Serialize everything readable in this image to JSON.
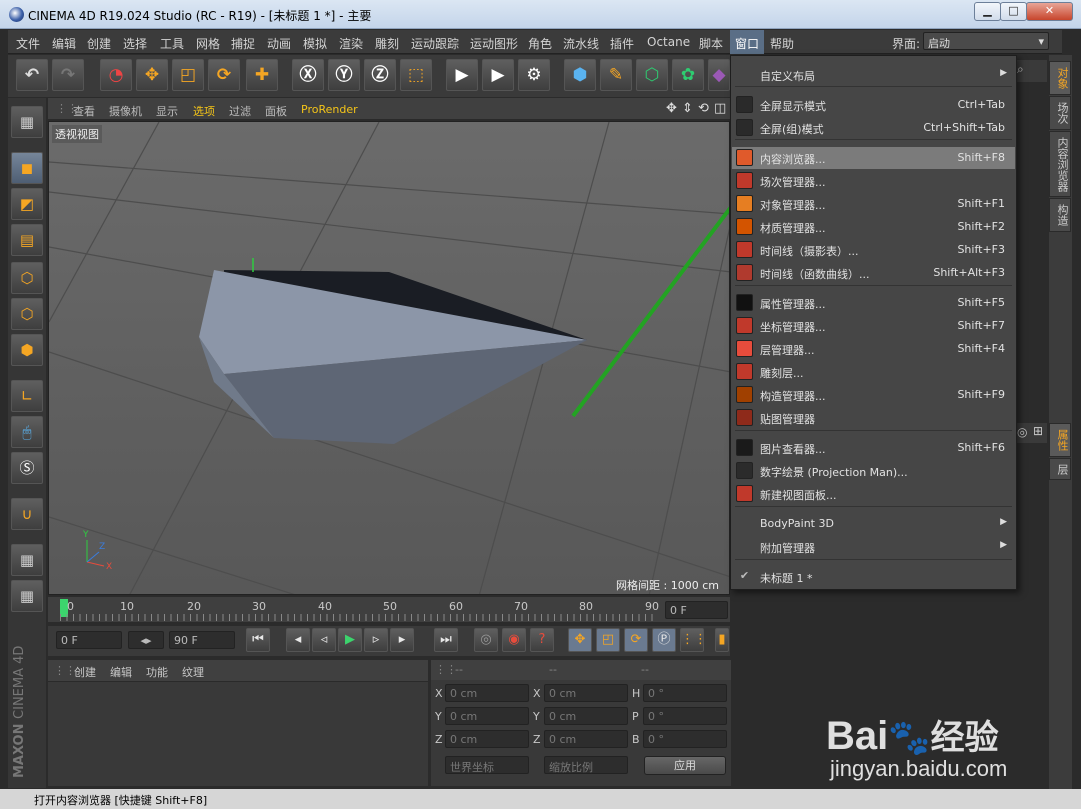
{
  "window": {
    "title": "CINEMA 4D R19.024 Studio (RC - R19) - [未标题 1 *] - 主要",
    "min": "▁",
    "max": "□",
    "close": "✕"
  },
  "menubar": {
    "items": [
      "文件",
      "编辑",
      "创建",
      "选择",
      "工具",
      "网格",
      "捕捉",
      "动画",
      "模拟",
      "渲染",
      "雕刻",
      "运动跟踪",
      "运动图形",
      "角色",
      "流水线",
      "插件",
      "Octane",
      "脚本",
      "窗口",
      "帮助"
    ],
    "layout_label": "界面:",
    "layout_value": "启动"
  },
  "toolbar": {
    "icons": [
      "undo-icon",
      "redo-icon",
      "select-icon",
      "move-icon",
      "scale-icon",
      "rotate-icon",
      "move-plus-icon",
      "x-axis-icon",
      "y-axis-icon",
      "z-axis-icon",
      "coord-system-icon",
      "render-view-icon",
      "render-picture-icon",
      "render-settings-icon",
      "cube-icon",
      "pen-icon",
      "subdivision-icon",
      "cloner-icon",
      "deformer-icon"
    ]
  },
  "viewport": {
    "menu": [
      "查看",
      "摄像机",
      "显示",
      "选项",
      "过滤",
      "面板",
      "ProRender"
    ],
    "label": "透视视图",
    "grid_spacing": "网格间距 : 1000 cm"
  },
  "timeline": {
    "ticks": [
      "0",
      "10",
      "20",
      "30",
      "40",
      "50",
      "60",
      "70",
      "80",
      "90"
    ],
    "current_frame": "0 F"
  },
  "playbar": {
    "start_field": "0 F",
    "end_field": "90 F"
  },
  "material_panel": {
    "menu": [
      "创建",
      "编辑",
      "功能",
      "纹理"
    ]
  },
  "coord_panel": {
    "headers": [
      "--",
      "--",
      "--"
    ],
    "rows": [
      {
        "a": "X",
        "av": "0 cm",
        "b": "X",
        "bv": "0 cm",
        "c": "H",
        "cv": "0 °"
      },
      {
        "a": "Y",
        "av": "0 cm",
        "b": "Y",
        "bv": "0 cm",
        "c": "P",
        "cv": "0 °"
      },
      {
        "a": "Z",
        "av": "0 cm",
        "b": "Z",
        "bv": "0 cm",
        "c": "B",
        "cv": "0 °"
      }
    ],
    "world_coords": "世界坐标",
    "scale": "缩放比例",
    "apply": "应用"
  },
  "right_tabs": [
    "对象",
    "场次",
    "内容浏览器",
    "构造",
    "属性",
    "层"
  ],
  "dropdown": {
    "items": [
      {
        "label": "自定义布局",
        "shortcut": "",
        "submenu": true,
        "icon_color": "#464646"
      },
      {
        "label": "全屏显示模式",
        "shortcut": "Ctrl+Tab",
        "icon_color": "#2a2a2a"
      },
      {
        "label": "全屏(组)模式",
        "shortcut": "Ctrl+Shift+Tab",
        "icon_color": "#2a2a2a"
      },
      {
        "label": "内容浏览器...",
        "shortcut": "Shift+F8",
        "highlight": true,
        "icon_color": "#e05a2b"
      },
      {
        "label": "场次管理器...",
        "shortcut": "",
        "icon_color": "#c0392b"
      },
      {
        "label": "对象管理器...",
        "shortcut": "Shift+F1",
        "icon_color": "#e67e22"
      },
      {
        "label": "材质管理器...",
        "shortcut": "Shift+F2",
        "icon_color": "#d35400"
      },
      {
        "label": "时间线（摄影表）...",
        "shortcut": "Shift+F3",
        "icon_color": "#c0392b"
      },
      {
        "label": "时间线（函数曲线）...",
        "shortcut": "Shift+Alt+F3",
        "icon_color": "#b03a2e"
      },
      {
        "label": "属性管理器...",
        "shortcut": "Shift+F5",
        "icon_color": "#111111"
      },
      {
        "label": "坐标管理器...",
        "shortcut": "Shift+F7",
        "icon_color": "#c0392b"
      },
      {
        "label": "层管理器...",
        "shortcut": "Shift+F4",
        "icon_color": "#e74c3c"
      },
      {
        "label": "雕刻层...",
        "shortcut": "",
        "icon_color": "#c0392b"
      },
      {
        "label": "构造管理器...",
        "shortcut": "Shift+F9",
        "icon_color": "#a04000"
      },
      {
        "label": "贴图管理器",
        "shortcut": "",
        "icon_color": "#8e2a1a"
      },
      {
        "label": "图片查看器...",
        "shortcut": "Shift+F6",
        "icon_color": "#1a1a1a"
      },
      {
        "label": "数字绘景 (Projection Man)...",
        "shortcut": "",
        "icon_color": "#2b2b2b"
      },
      {
        "label": "新建视图面板...",
        "shortcut": "",
        "icon_color": "#c0392b"
      },
      {
        "label": "BodyPaint 3D",
        "shortcut": "",
        "submenu": true,
        "icon_color": "#464646"
      },
      {
        "label": "附加管理器",
        "shortcut": "",
        "submenu": true,
        "icon_color": "#464646"
      },
      {
        "label": "未标题 1 *",
        "shortcut": "",
        "check": true,
        "icon_color": "#464646"
      }
    ]
  },
  "statusbar": {
    "text": "打开内容浏览器 [快捷键 Shift+F8]"
  },
  "brand": {
    "maxon": "MAXON",
    "c4d": "CINEMA 4D"
  },
  "watermark": {
    "brand": "Bai",
    "paw": "🐾",
    "jingyan": "经验",
    "url": "jingyan.baidu.com"
  }
}
